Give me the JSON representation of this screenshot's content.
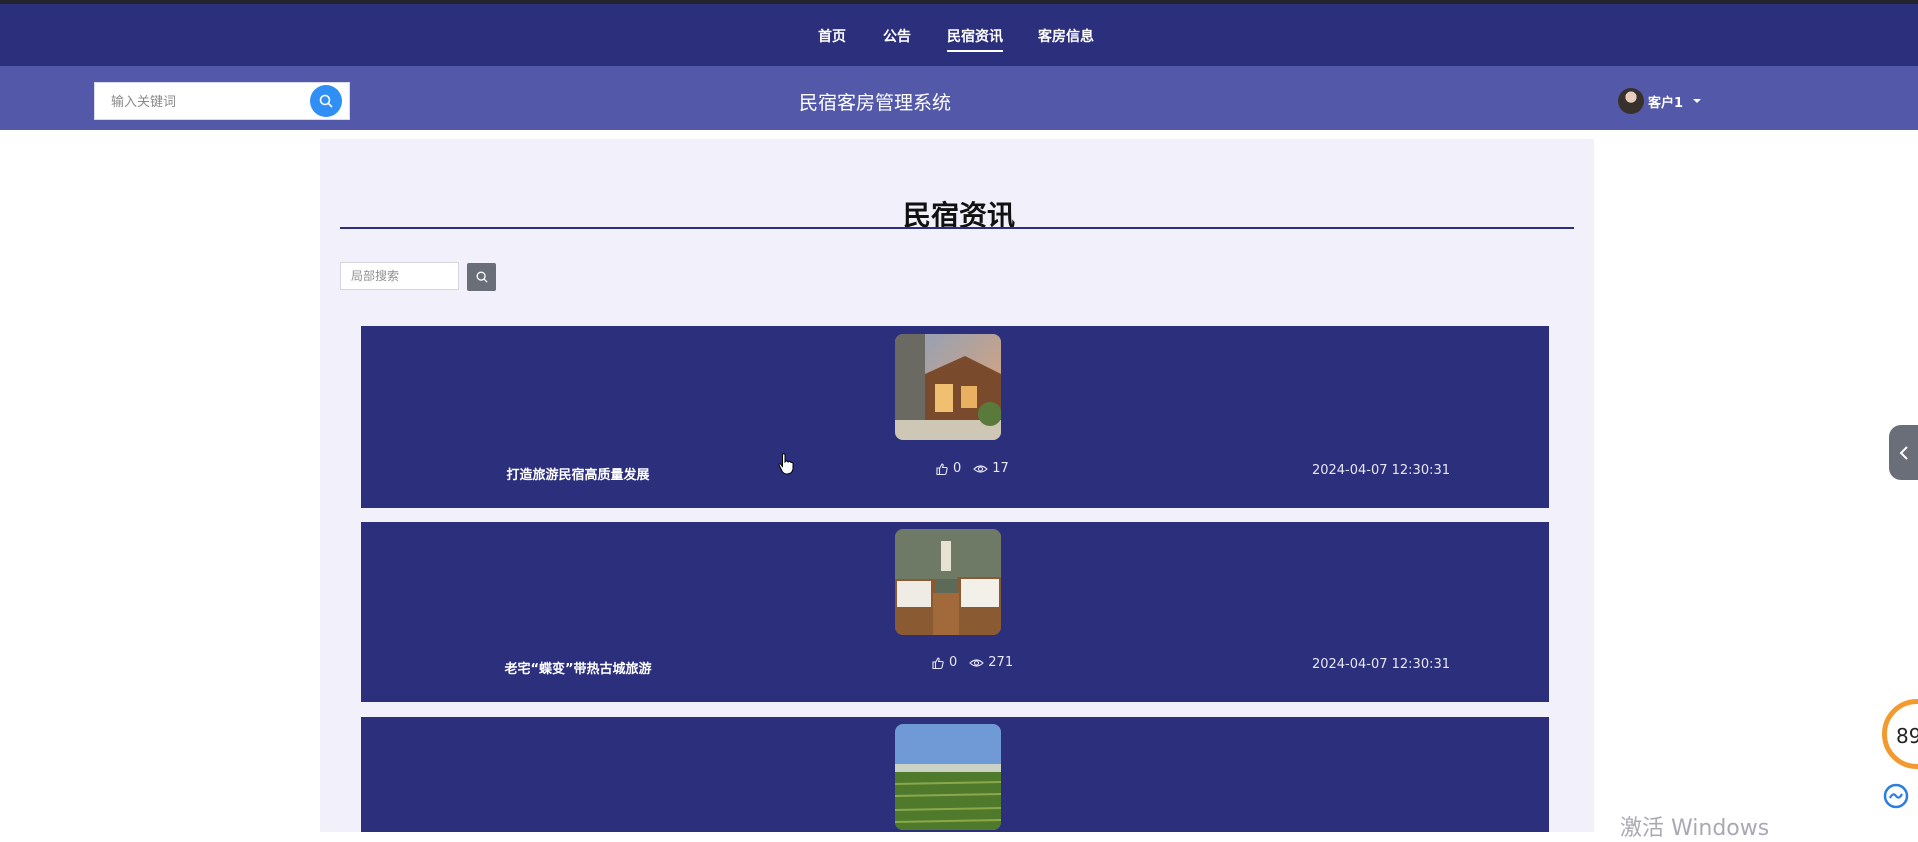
{
  "nav": {
    "items": [
      {
        "label": "首页"
      },
      {
        "label": "公告"
      },
      {
        "label": "民宿资讯"
      },
      {
        "label": "客房信息"
      }
    ],
    "active": "民宿资讯"
  },
  "header": {
    "search_placeholder": "输入关键词",
    "site_title": "民宿客房管理系统",
    "user_name": "客户1"
  },
  "page": {
    "title": "民宿资讯",
    "local_search_placeholder": "局部搜索"
  },
  "articles": [
    {
      "title": "打造旅游民宿高质量发展",
      "likes": "0",
      "views": "17",
      "date": "2024-04-07 12:30:31",
      "image": "courtyard-villa"
    },
    {
      "title": "老宅“蝶变”带热古城旅游",
      "likes": "0",
      "views": "271",
      "date": "2024-04-07 12:30:31",
      "image": "twin-bedroom"
    },
    {
      "title": "",
      "likes": "",
      "views": "",
      "date": "",
      "image": "rice-field"
    }
  ],
  "floating": {
    "number": "89"
  },
  "watermark": "激活 Windows",
  "colors": {
    "nav_bg": "#2b2f7c",
    "subbar_bg": "#5358a8",
    "card_bg": "#2b2f7c",
    "content_bg": "#f1f0fb",
    "search_btn": "#2f8ff5",
    "ring": "#f39a2e"
  }
}
